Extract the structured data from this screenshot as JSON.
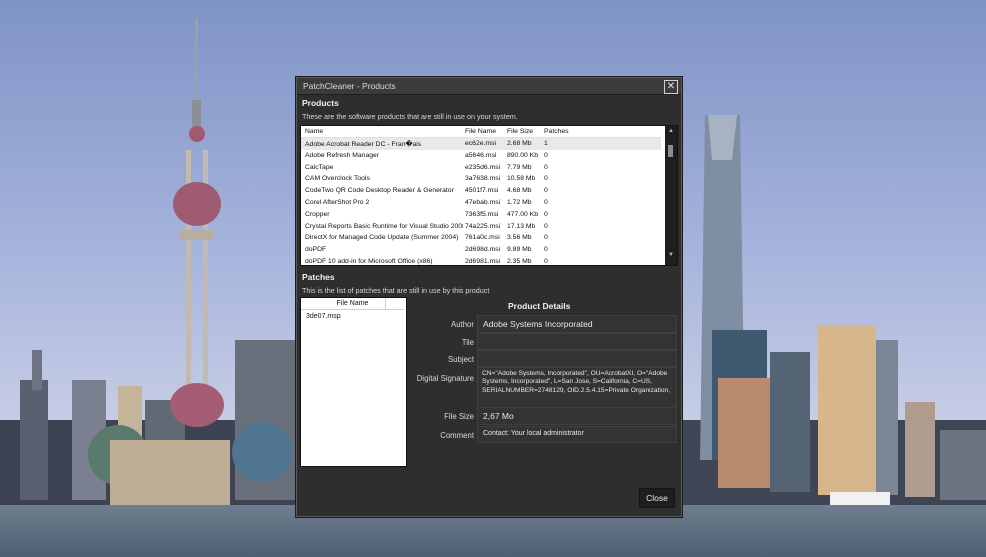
{
  "window": {
    "title": "PatchCleaner - Products",
    "close_symbol": "✕"
  },
  "products": {
    "heading": "Products",
    "description": "These are the software products that are still in use on your system.",
    "columns": [
      "Name",
      "File Name",
      "File Size",
      "Patches"
    ],
    "rows": [
      {
        "name": "Adobe Acrobat Reader DC - Fran�ais",
        "file": "ec62e.msi",
        "size": "2.68 Mb",
        "patches": "1"
      },
      {
        "name": "Adobe Refresh Manager",
        "file": "a5646.msi",
        "size": "890.00 Kb",
        "patches": "0"
      },
      {
        "name": "CalcTape",
        "file": "e235d6.msi",
        "size": "7.79 Mb",
        "patches": "0"
      },
      {
        "name": "CAM Overclock Tools",
        "file": "3a7638.msi",
        "size": "10.58 Mb",
        "patches": "0"
      },
      {
        "name": "CodeTwo QR Code Desktop Reader & Generator",
        "file": "4501f7.msi",
        "size": "4.68 Mb",
        "patches": "0"
      },
      {
        "name": "Corel AfterShot Pro 2",
        "file": "47ebab.msi",
        "size": "1.72 Mb",
        "patches": "0"
      },
      {
        "name": "Cropper",
        "file": "7363f5.msi",
        "size": "477.00 Kb",
        "patches": "0"
      },
      {
        "name": "Crystal Reports Basic Runtime for Visual Studio 2008",
        "file": "74a225.msi",
        "size": "17.13 Mb",
        "patches": "0"
      },
      {
        "name": "DirectX for Managed Code Update (Summer 2004)",
        "file": "761a0c.msi",
        "size": "3.56 Mb",
        "patches": "0"
      },
      {
        "name": "doPDF",
        "file": "2d698d.msi",
        "size": "9.89 Mb",
        "patches": "0"
      },
      {
        "name": "doPDF 10 add-in for Microsoft Office (x86)",
        "file": "2d6981.msi",
        "size": "2.35 Mb",
        "patches": "0"
      }
    ],
    "selected_index": 0
  },
  "patches": {
    "heading": "Patches",
    "description": "This is the list of patches that are still in use by this product",
    "column": "File Name",
    "items": [
      "3de07.msp"
    ]
  },
  "details": {
    "heading": "Product Details",
    "labels": {
      "author": "Author",
      "title": "Tile",
      "subject": "Subject",
      "signature": "Digital Signature",
      "filesize": "File Size",
      "comment": "Comment"
    },
    "values": {
      "author": "Adobe Systems Incorporated",
      "title": "",
      "subject": "",
      "signature": "CN=\"Adobe Systems, Incorporated\", OU=AcrobatXI, O=\"Adobe Systems, Incorporated\", L=San Jose, S=California, C=US, SERIALNUMBER=2748129, OID.2.5.4.15=Private Organization,",
      "filesize": "2,67 Mo",
      "comment": "Contact:  Your local administrator"
    }
  },
  "buttons": {
    "close": "Close"
  },
  "colors": {
    "window_bg": "#2e2e2e",
    "titlebar_bg": "#3b3b3b",
    "selected_row": "#e9e9e9"
  }
}
